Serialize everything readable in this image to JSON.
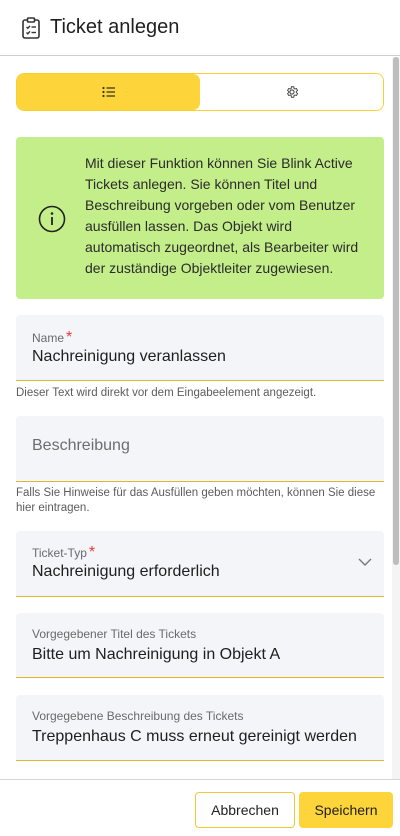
{
  "header": {
    "title": "Ticket anlegen",
    "icon": "clipboard-checklist-icon"
  },
  "tabs": {
    "active": "list-icon",
    "items": [
      {
        "icon": "list-icon",
        "active": true
      },
      {
        "icon": "gear-icon",
        "active": false
      }
    ],
    "accent_color": "#fdd43a"
  },
  "info": {
    "icon": "info-circle-icon",
    "text": "Mit dieser Funktion können Sie Blink Active Tickets anlegen. Sie können Titel und Beschreibung vorgeben oder vom Benutzer ausfüllen lassen. Das Objekt wird automatisch zugeordnet, als Bearbeiter wird der zuständige Objektleiter zugewiesen.",
    "background": "#c4ee8a"
  },
  "fields": {
    "name": {
      "label": "Name",
      "required_marker": "*",
      "value": "Nachreinigung veranlassen",
      "hint": "Dieser Text wird direkt vor dem Eingabeelement angezeigt."
    },
    "description": {
      "placeholder": "Beschreibung",
      "hint": "Falls Sie Hinweise für das Ausfüllen geben möchten, können Sie diese hier eintragen."
    },
    "ticket_type": {
      "label": "Ticket-Typ",
      "required_marker": "*",
      "value": "Nachreinigung erforderlich"
    },
    "ticket_title": {
      "label": "Vorgegebener Titel des Tickets",
      "value": "Bitte um Nachreinigung in Objekt A"
    },
    "ticket_description": {
      "label": "Vorgegebene Beschreibung des Tickets",
      "value": "Treppenhaus C muss erneut gereinigt werden"
    }
  },
  "footer": {
    "cancel_label": "Abbrechen",
    "save_label": "Speichern"
  },
  "colors": {
    "accent": "#fdd43a",
    "required": "#e53935",
    "field_background": "#f4f5f8"
  }
}
